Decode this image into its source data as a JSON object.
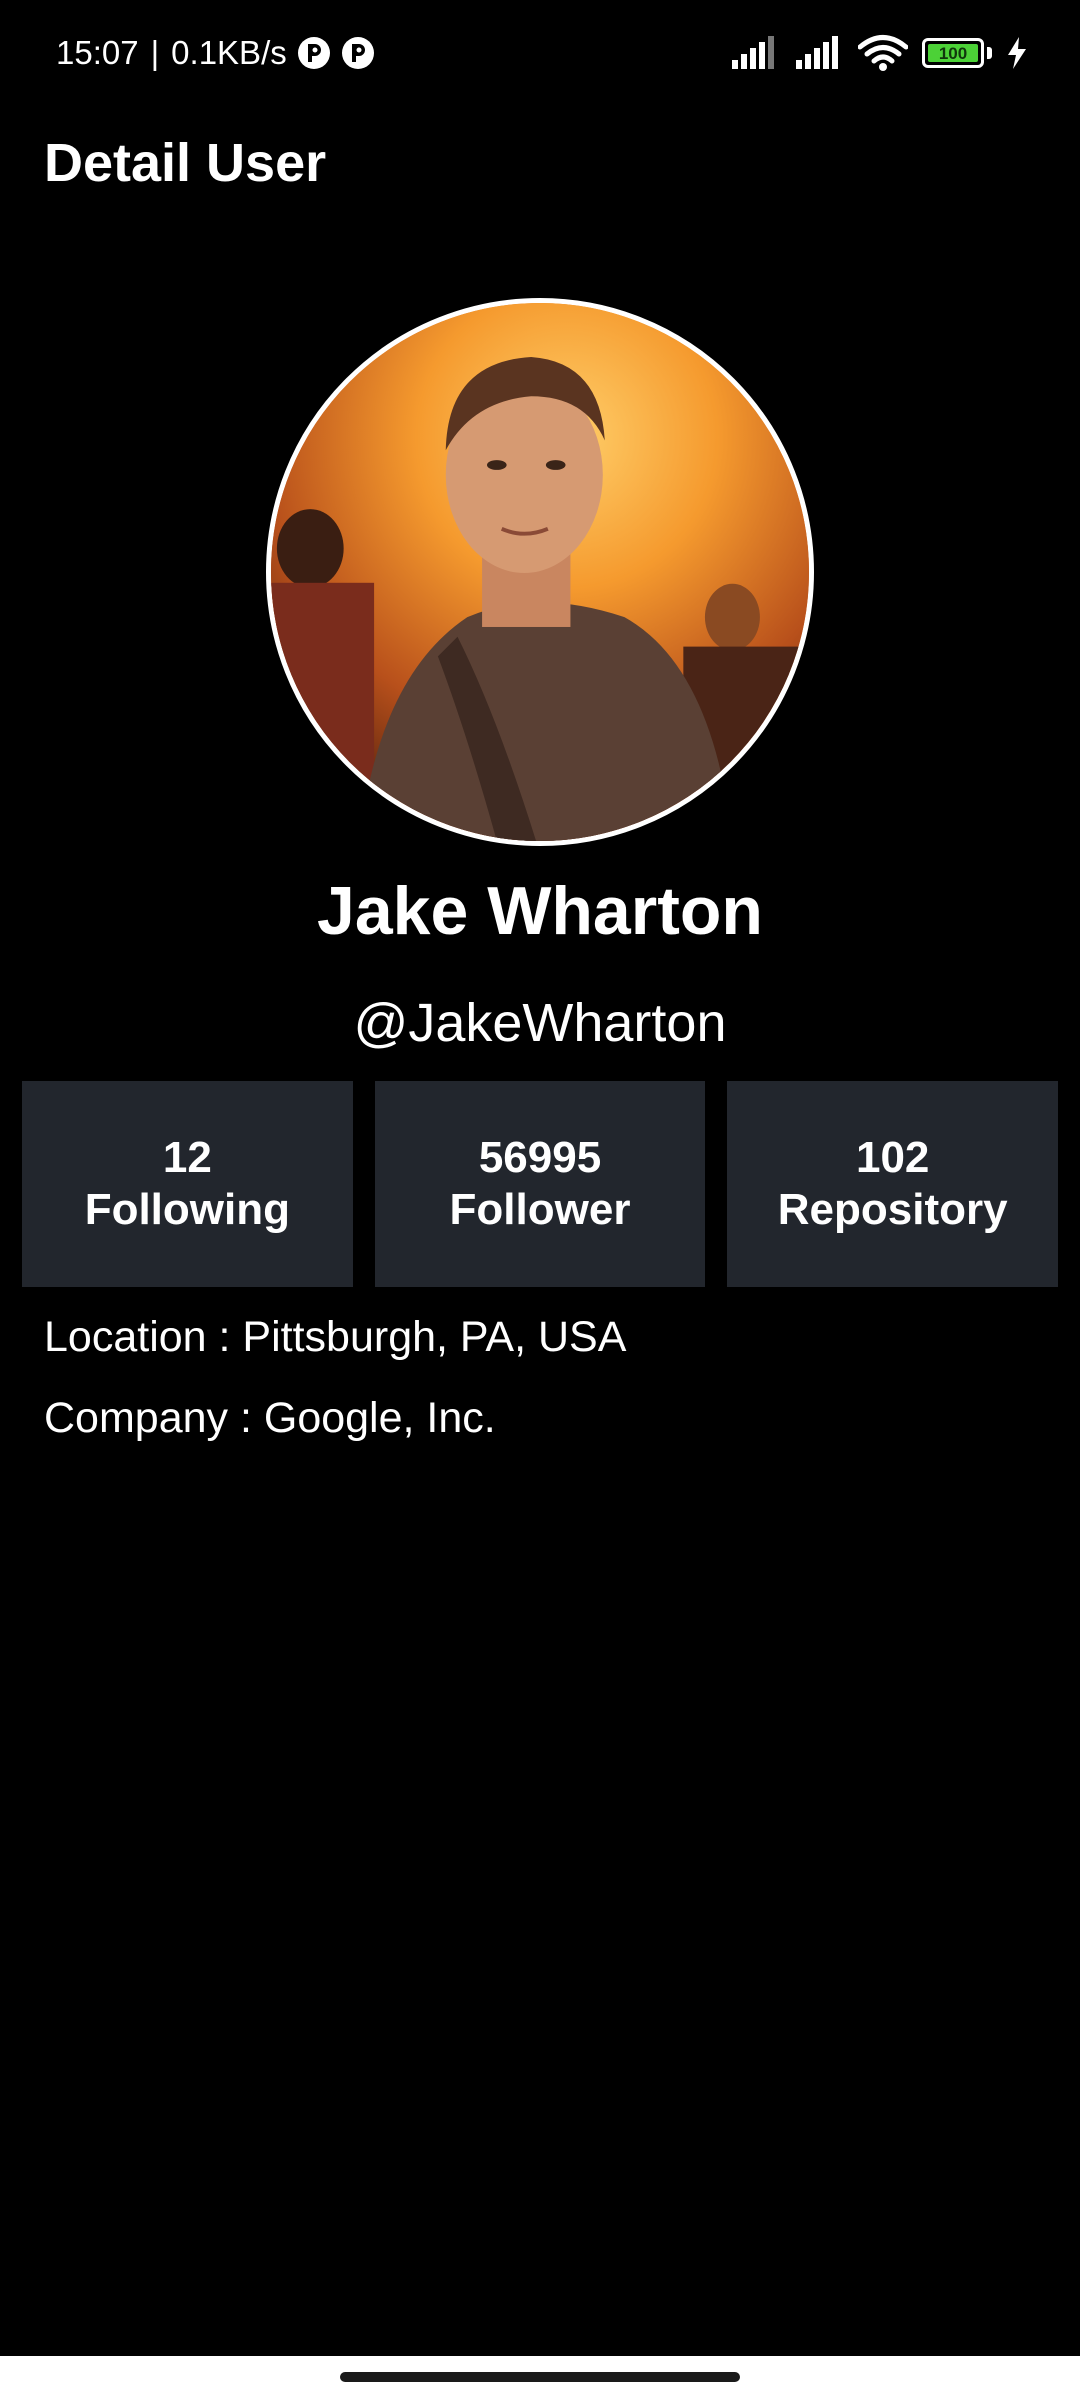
{
  "status_bar": {
    "time": "15:07",
    "separator": "|",
    "network_speed": "0.1KB/s",
    "battery_level": "100",
    "battery_color": "#4cd137"
  },
  "app_bar": {
    "title": "Detail User"
  },
  "profile": {
    "avatar_alt": "avatar-photo",
    "full_name": "Jake Wharton",
    "username": "@JakeWharton"
  },
  "stats": [
    {
      "value": "12",
      "label": "Following"
    },
    {
      "value": "56995",
      "label": "Follower"
    },
    {
      "value": "102",
      "label": "Repository"
    }
  ],
  "details": {
    "location": "Location : Pittsburgh, PA, USA",
    "company": "Company : Google, Inc."
  },
  "colors": {
    "background": "#000000",
    "card": "#22262d",
    "text": "#ffffff"
  }
}
